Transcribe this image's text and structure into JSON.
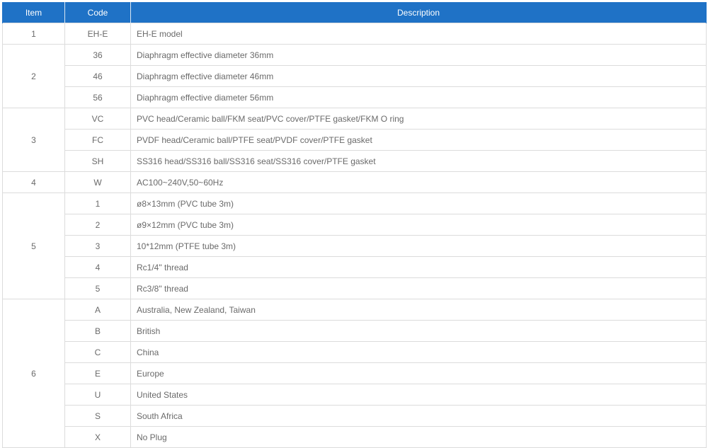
{
  "headers": {
    "item": "Item",
    "code": "Code",
    "description": "Description"
  },
  "groups": [
    {
      "item": "1",
      "rows": [
        {
          "code": "EH-E",
          "description": "EH-E model"
        }
      ]
    },
    {
      "item": "2",
      "rows": [
        {
          "code": "36",
          "description": "Diaphragm effective diameter 36mm"
        },
        {
          "code": "46",
          "description": "Diaphragm effective diameter 46mm"
        },
        {
          "code": "56",
          "description": "Diaphragm effective diameter 56mm"
        }
      ]
    },
    {
      "item": "3",
      "rows": [
        {
          "code": "VC",
          "description": "PVC head/Ceramic ball/FKM seat/PVC cover/PTFE gasket/FKM O ring"
        },
        {
          "code": "FC",
          "description": "PVDF head/Ceramic ball/PTFE seat/PVDF cover/PTFE gasket"
        },
        {
          "code": "SH",
          "description": "SS316 head/SS316 ball/SS316 seat/SS316 cover/PTFE gasket"
        }
      ]
    },
    {
      "item": "4",
      "rows": [
        {
          "code": "W",
          "description": "AC100~240V,50~60Hz"
        }
      ]
    },
    {
      "item": "5",
      "rows": [
        {
          "code": "1",
          "description": "ø8×13mm (PVC  tube 3m)"
        },
        {
          "code": "2",
          "description": "ø9×12mm (PVC  tube 3m)"
        },
        {
          "code": "3",
          "description": "10*12mm (PTFE tube 3m)"
        },
        {
          "code": "4",
          "description": "Rc1/4\" thread"
        },
        {
          "code": "5",
          "description": "Rc3/8\" thread"
        }
      ]
    },
    {
      "item": "6",
      "rows": [
        {
          "code": "A",
          "description": "Australia, New Zealand, Taiwan"
        },
        {
          "code": "B",
          "description": "British"
        },
        {
          "code": "C",
          "description": "China"
        },
        {
          "code": "E",
          "description": "Europe"
        },
        {
          "code": "U",
          "description": "United States"
        },
        {
          "code": "S",
          "description": "South Africa"
        },
        {
          "code": "X",
          "description": "No Plug"
        }
      ]
    }
  ],
  "colors": {
    "header_bg": "#1f72c6",
    "header_text": "#ffffff",
    "border": "#dcdcdc",
    "body_text": "#6a6a6a"
  }
}
